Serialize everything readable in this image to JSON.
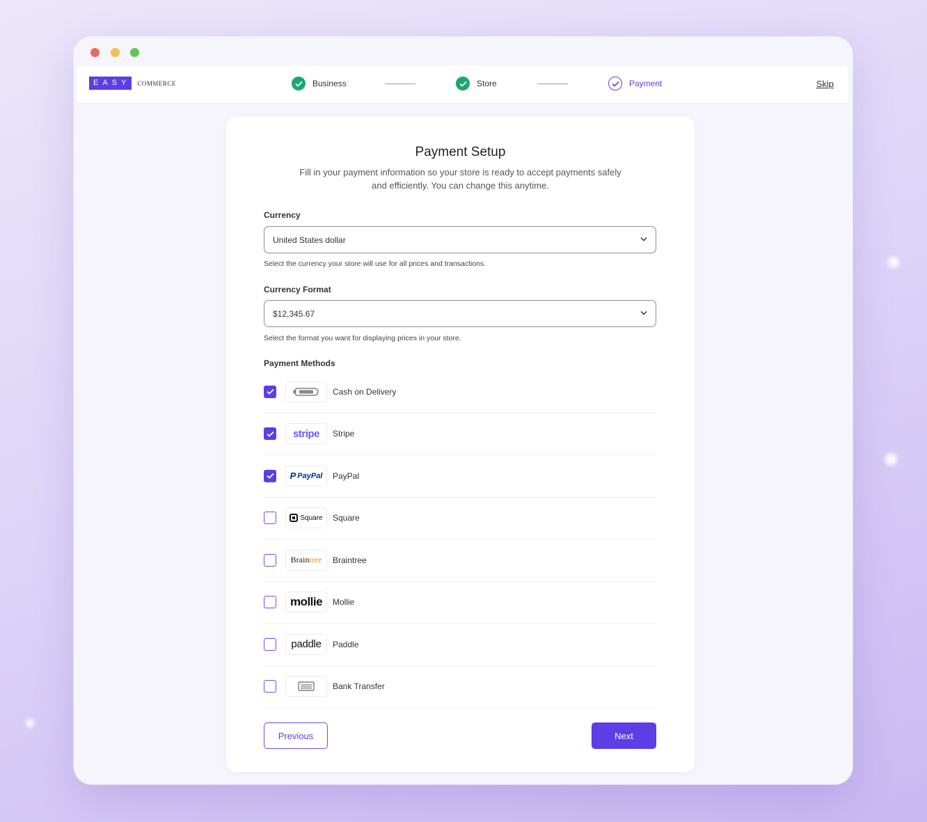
{
  "logo": {
    "mark": "EASY",
    "sub": "COMMERCE"
  },
  "steps": [
    {
      "label": "Business",
      "status": "done"
    },
    {
      "label": "Store",
      "status": "done"
    },
    {
      "label": "Payment",
      "status": "current"
    }
  ],
  "header": {
    "skip_label": "Skip"
  },
  "form": {
    "title": "Payment Setup",
    "subtitle": "Fill in your payment information so your store is ready to accept payments safely and efficiently. You can change this anytime.",
    "currency": {
      "label": "Currency",
      "value": "United States dollar",
      "help": "Select the currency your store will use for all prices and transactions."
    },
    "currency_format": {
      "label": "Currency Format",
      "value": "$12,345.67",
      "help": "Select the format you want for displaying prices in your store."
    },
    "methods_label": "Payment Methods",
    "methods": [
      {
        "name": "Cash on Delivery",
        "checked": true,
        "logo": "cash-icon"
      },
      {
        "name": "Stripe",
        "checked": true,
        "logo": "stripe"
      },
      {
        "name": "PayPal",
        "checked": true,
        "logo": "PayPal"
      },
      {
        "name": "Square",
        "checked": false,
        "logo": "Square"
      },
      {
        "name": "Braintree",
        "checked": false,
        "logo": "Braintree"
      },
      {
        "name": "Mollie",
        "checked": false,
        "logo": "mollie"
      },
      {
        "name": "Paddle",
        "checked": false,
        "logo": "paddle"
      },
      {
        "name": "Bank Transfer",
        "checked": false,
        "logo": "bank-icon"
      }
    ],
    "previous_label": "Previous",
    "next_label": "Next"
  },
  "colors": {
    "accent": "#5b3ee6",
    "success": "#1ba672"
  }
}
